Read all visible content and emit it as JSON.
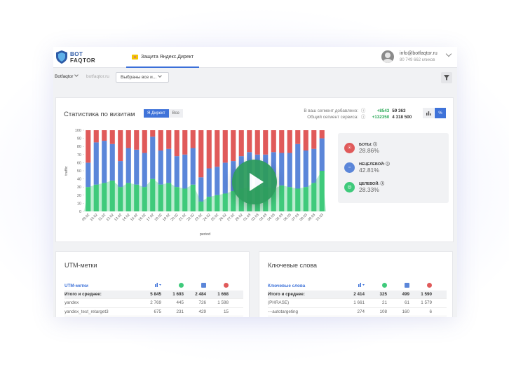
{
  "header": {
    "logo_line1": "BOT",
    "logo_line2": "FAQTOR",
    "active_tab": "Защита Яндекс.Директ",
    "user_email": "info@botfaqtor.ru",
    "user_balance": "80 749 662 кликов"
  },
  "filters": {
    "account": "Botfaqtor",
    "site": "botfaqtor.ru",
    "select_value": "Выбраны все и..."
  },
  "stats": {
    "title": "Статистика по визитам",
    "source_tabs": [
      "Я.Директ",
      "Все"
    ],
    "segment_added_label": "В ваш сегмент добавлено:",
    "segment_added_delta": "+8543",
    "segment_added_total": "59 363",
    "service_segment_label": "Общий сегмент сервиса:",
    "service_segment_delta": "+132350",
    "service_segment_total": "4 318 500"
  },
  "legend": {
    "bots_label": "БОТЫ:",
    "bots_value": "28.86%",
    "nontarget_label": "НЕЦЕЛЕВОЙ:",
    "nontarget_value": "42.81%",
    "target_label": "ЦЕЛЕВОЙ:",
    "target_value": "28.33%"
  },
  "colors": {
    "bots": "#e05a5a",
    "nontarget": "#5b86d9",
    "target": "#3fca7b",
    "accent": "#3f73d9"
  },
  "chart_data": {
    "type": "bar",
    "stacked": true,
    "xlabel": "period",
    "ylabel": "traffic",
    "ylim": [
      0,
      100
    ],
    "yticks": [
      0,
      10,
      20,
      30,
      40,
      50,
      60,
      70,
      80,
      90,
      100
    ],
    "categories": [
      "09.02",
      "10.02",
      "11.02",
      "12.02",
      "13.02",
      "14.02",
      "15.02",
      "16.02",
      "17.02",
      "18.02",
      "19.02",
      "20.02",
      "21.02",
      "22.02",
      "23.02",
      "24.02",
      "25.02",
      "26.02",
      "27.02",
      "28.02",
      "01.03",
      "02.03",
      "03.03",
      "04.03",
      "05.03",
      "06.03",
      "07.03",
      "08.03",
      "09.03",
      "10.03"
    ],
    "series": [
      {
        "name": "ЦЕЛЕВОЙ",
        "values": [
          30,
          33,
          35,
          38,
          30,
          35,
          33,
          30,
          40,
          33,
          35,
          30,
          28,
          33,
          12,
          18,
          20,
          22,
          25,
          28,
          30,
          32,
          30,
          28,
          32,
          30,
          28,
          30,
          35,
          50
        ]
      },
      {
        "name": "НЕЦЕЛЕВОЙ",
        "values": [
          30,
          52,
          52,
          45,
          32,
          43,
          43,
          42,
          52,
          42,
          42,
          38,
          42,
          45,
          30,
          35,
          35,
          38,
          37,
          40,
          43,
          38,
          40,
          45,
          40,
          42,
          55,
          45,
          42,
          40
        ]
      },
      {
        "name": "БОТЫ",
        "values": [
          40,
          15,
          13,
          17,
          38,
          22,
          24,
          28,
          8,
          25,
          23,
          32,
          30,
          22,
          58,
          47,
          45,
          40,
          38,
          32,
          27,
          30,
          30,
          27,
          28,
          28,
          17,
          25,
          23,
          10
        ]
      }
    ]
  },
  "utm": {
    "title": "UTM-метки",
    "col0": "UTM-метки",
    "total_label": "Итого и среднее:",
    "total": [
      "5 845",
      "1 693",
      "2 484",
      "1 668"
    ],
    "rows": [
      {
        "name": "yandex",
        "vals": [
          "2 769",
          "445",
          "726",
          "1 598"
        ]
      },
      {
        "name": "yandex_test_retarget3",
        "vals": [
          "675",
          "231",
          "429",
          "15"
        ]
      }
    ]
  },
  "keywords": {
    "title": "Ключевые слова",
    "col0": "Ключевые слова",
    "total_label": "Итого и среднее:",
    "total": [
      "2 414",
      "325",
      "499",
      "1 590"
    ],
    "rows": [
      {
        "name": "(PHRASE)",
        "vals": [
          "1 661",
          "21",
          "61",
          "1 579"
        ]
      },
      {
        "name": "---autotargeting",
        "vals": [
          "274",
          "108",
          "160",
          "6"
        ]
      }
    ]
  }
}
